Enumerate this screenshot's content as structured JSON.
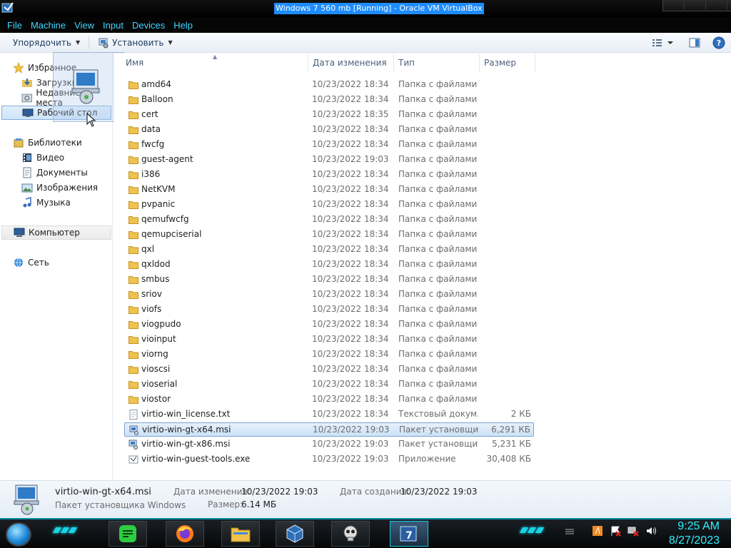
{
  "vbox": {
    "title": "Windows 7 560 mb [Running] - Oracle VM VirtualBox",
    "menu": [
      "File",
      "Machine",
      "View",
      "Input",
      "Devices",
      "Help"
    ]
  },
  "toolbar": {
    "organize": "Упорядочить",
    "install": "Установить"
  },
  "nav": {
    "favorites": "Избранное",
    "downloads": "Загрузки",
    "recent": "Недавние места",
    "desktop": "Рабочий стол",
    "libraries": "Библиотеки",
    "video": "Видео",
    "documents": "Документы",
    "images": "Изображения",
    "music": "Музыка",
    "computer": "Компьютер",
    "network": "Сеть"
  },
  "columns": {
    "name": "Имя",
    "date": "Дата изменения",
    "type": "Тип",
    "size": "Размер"
  },
  "files": [
    {
      "name": "amd64",
      "date": "10/23/2022 18:34",
      "type": "Папка с файлами",
      "size": "",
      "kind": "folder"
    },
    {
      "name": "Balloon",
      "date": "10/23/2022 18:34",
      "type": "Папка с файлами",
      "size": "",
      "kind": "folder"
    },
    {
      "name": "cert",
      "date": "10/23/2022 18:35",
      "type": "Папка с файлами",
      "size": "",
      "kind": "folder"
    },
    {
      "name": "data",
      "date": "10/23/2022 18:34",
      "type": "Папка с файлами",
      "size": "",
      "kind": "folder"
    },
    {
      "name": "fwcfg",
      "date": "10/23/2022 18:34",
      "type": "Папка с файлами",
      "size": "",
      "kind": "folder"
    },
    {
      "name": "guest-agent",
      "date": "10/23/2022 19:03",
      "type": "Папка с файлами",
      "size": "",
      "kind": "folder"
    },
    {
      "name": "i386",
      "date": "10/23/2022 18:34",
      "type": "Папка с файлами",
      "size": "",
      "kind": "folder"
    },
    {
      "name": "NetKVM",
      "date": "10/23/2022 18:34",
      "type": "Папка с файлами",
      "size": "",
      "kind": "folder"
    },
    {
      "name": "pvpanic",
      "date": "10/23/2022 18:34",
      "type": "Папка с файлами",
      "size": "",
      "kind": "folder"
    },
    {
      "name": "qemufwcfg",
      "date": "10/23/2022 18:34",
      "type": "Папка с файлами",
      "size": "",
      "kind": "folder"
    },
    {
      "name": "qemupciserial",
      "date": "10/23/2022 18:34",
      "type": "Папка с файлами",
      "size": "",
      "kind": "folder"
    },
    {
      "name": "qxl",
      "date": "10/23/2022 18:34",
      "type": "Папка с файлами",
      "size": "",
      "kind": "folder"
    },
    {
      "name": "qxldod",
      "date": "10/23/2022 18:34",
      "type": "Папка с файлами",
      "size": "",
      "kind": "folder"
    },
    {
      "name": "smbus",
      "date": "10/23/2022 18:34",
      "type": "Папка с файлами",
      "size": "",
      "kind": "folder"
    },
    {
      "name": "sriov",
      "date": "10/23/2022 18:34",
      "type": "Папка с файлами",
      "size": "",
      "kind": "folder"
    },
    {
      "name": "viofs",
      "date": "10/23/2022 18:34",
      "type": "Папка с файлами",
      "size": "",
      "kind": "folder"
    },
    {
      "name": "viogpudo",
      "date": "10/23/2022 18:34",
      "type": "Папка с файлами",
      "size": "",
      "kind": "folder"
    },
    {
      "name": "vioinput",
      "date": "10/23/2022 18:34",
      "type": "Папка с файлами",
      "size": "",
      "kind": "folder"
    },
    {
      "name": "viorng",
      "date": "10/23/2022 18:34",
      "type": "Папка с файлами",
      "size": "",
      "kind": "folder"
    },
    {
      "name": "vioscsi",
      "date": "10/23/2022 18:34",
      "type": "Папка с файлами",
      "size": "",
      "kind": "folder"
    },
    {
      "name": "vioserial",
      "date": "10/23/2022 18:34",
      "type": "Папка с файлами",
      "size": "",
      "kind": "folder"
    },
    {
      "name": "viostor",
      "date": "10/23/2022 18:34",
      "type": "Папка с файлами",
      "size": "",
      "kind": "folder"
    },
    {
      "name": "virtio-win_license.txt",
      "date": "10/23/2022 18:34",
      "type": "Текстовый докум...",
      "size": "2 КБ",
      "kind": "text"
    },
    {
      "name": "virtio-win-gt-x64.msi",
      "date": "10/23/2022 19:03",
      "type": "Пакет установщи...",
      "size": "6,291 КБ",
      "kind": "msi",
      "selected": true
    },
    {
      "name": "virtio-win-gt-x86.msi",
      "date": "10/23/2022 19:03",
      "type": "Пакет установщи...",
      "size": "5,231 КБ",
      "kind": "msi"
    },
    {
      "name": "virtio-win-guest-tools.exe",
      "date": "10/23/2022 19:03",
      "type": "Приложение",
      "size": "30,408 КБ",
      "kind": "exe"
    }
  ],
  "details": {
    "name": "virtio-win-gt-x64.msi",
    "type": "Пакет установщика Windows",
    "modified_label": "Дата изменения:",
    "modified": "10/23/2022 19:03",
    "created_label": "Дата создания:",
    "created": "10/23/2022 19:03",
    "size_label": "Размер:",
    "size": "6.14 МБ"
  },
  "clock": {
    "time": "9:25 AM",
    "date": "8/27/2023"
  },
  "colors": {
    "accent": "#19d3e6",
    "selection": "#cde2f8",
    "vbox_menu": "#3fd5ff"
  }
}
